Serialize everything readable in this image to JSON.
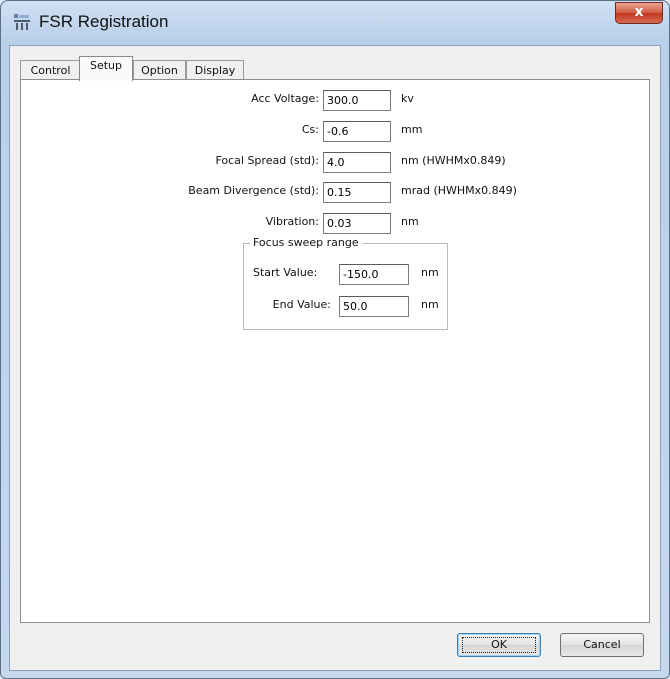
{
  "window": {
    "title": "FSR Registration",
    "close_glyph": "x",
    "icon": "fsr-app-icon"
  },
  "tabs": [
    {
      "label": "Control",
      "active": false
    },
    {
      "label": "Setup",
      "active": true
    },
    {
      "label": "Option",
      "active": false
    },
    {
      "label": "Display",
      "active": false
    }
  ],
  "setup": {
    "acc_voltage": {
      "label": "Acc Voltage:",
      "value": "300.0",
      "unit": "kv"
    },
    "cs": {
      "label": "Cs:",
      "value": "-0.6",
      "unit": "mm"
    },
    "focal_spread": {
      "label": "Focal Spread (std):",
      "value": "4.0",
      "unit": "nm (HWHMx0.849)"
    },
    "beam_divergence": {
      "label": "Beam Divergence (std):",
      "value": "0.15",
      "unit": "mrad (HWHMx0.849)"
    },
    "vibration": {
      "label": "Vibration:",
      "value": "0.03",
      "unit": "nm"
    },
    "focus_sweep": {
      "title": "Focus sweep range",
      "start": {
        "label": "Start Value:",
        "value": "-150.0",
        "unit": "nm"
      },
      "end": {
        "label": "End Value:",
        "value": "50.0",
        "unit": "nm"
      }
    }
  },
  "buttons": {
    "ok": "OK",
    "cancel": "Cancel"
  },
  "colors": {
    "close_button": "#c7452c",
    "title_bar": "#c2d6ed"
  }
}
